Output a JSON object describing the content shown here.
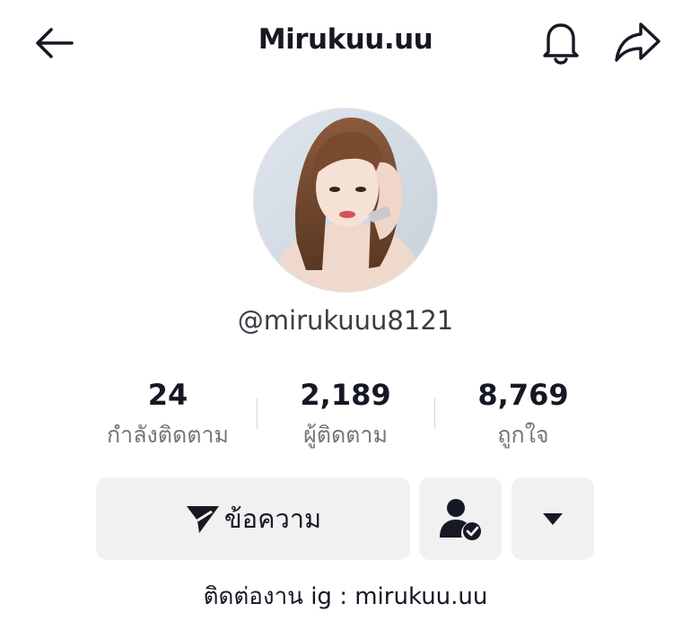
{
  "header": {
    "title": "Mirukuu.uu",
    "back_icon": "arrow-left-icon",
    "notification_icon": "bell-icon",
    "share_icon": "share-arrow-icon"
  },
  "profile": {
    "avatar": "profile-photo",
    "handle": "@mirukuuu8121",
    "bio": "ติดต่องาน ig : mirukuu.uu"
  },
  "stats": [
    {
      "value": "24",
      "label": "กำลังติดตาม"
    },
    {
      "value": "2,189",
      "label": "ผู้ติดตาม"
    },
    {
      "value": "8,769",
      "label": "ถูกใจ"
    }
  ],
  "actions": {
    "message_label": "ข้อความ",
    "message_icon": "send-icon",
    "friends_icon": "user-check-icon",
    "more_icon": "caret-down-icon"
  },
  "colors": {
    "text_primary": "#161823",
    "text_secondary": "#75767c",
    "button_bg": "#f1f1f2"
  }
}
